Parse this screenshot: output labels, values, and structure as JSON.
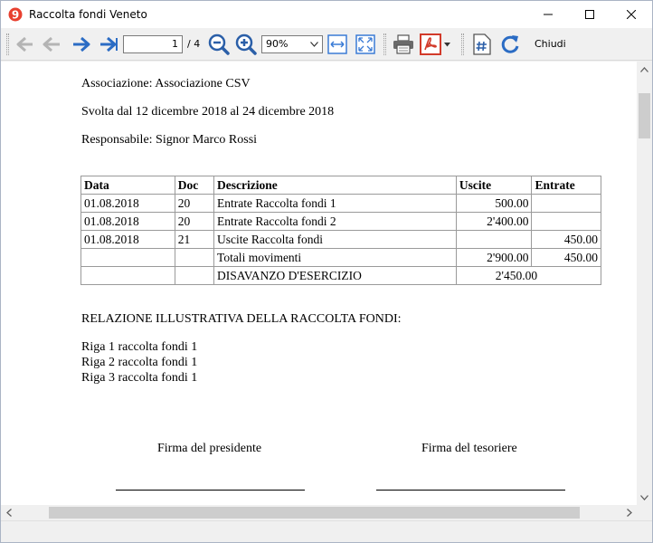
{
  "window": {
    "title": "Raccolta fondi Veneto"
  },
  "toolbar": {
    "page_value": "1",
    "page_total": "/ 4",
    "zoom_value": "90%",
    "close_label": "Chiudi"
  },
  "report": {
    "association": "Associazione: Associazione CSV",
    "period": "Svolta dal 12 dicembre 2018 al 24 dicembre 2018",
    "manager": "Responsabile: Signor Marco Rossi",
    "table": {
      "headers": [
        "Data",
        "Doc",
        "Descrizione",
        "Uscite",
        "Entrate"
      ],
      "rows": [
        {
          "data": "01.08.2018",
          "doc": "20",
          "descrizione": "Entrate Raccolta fondi 1",
          "uscite": "500.00",
          "entrate": ""
        },
        {
          "data": "01.08.2018",
          "doc": "20",
          "descrizione": "Entrate Raccolta fondi 2",
          "uscite": "2'400.00",
          "entrate": ""
        },
        {
          "data": "01.08.2018",
          "doc": "21",
          "descrizione": "Uscite Raccolta fondi",
          "uscite": "",
          "entrate": "450.00"
        }
      ],
      "totals_label": "Totali movimenti",
      "totals_uscite": "2'900.00",
      "totals_entrate": "450.00",
      "deficit_label": "DISAVANZO D'ESERCIZIO",
      "deficit_value": "2'450.00"
    },
    "report_heading": "RELAZIONE ILLUSTRATIVA DELLA RACCOLTA FONDI:",
    "lines": [
      "Riga 1 raccolta fondi 1",
      "Riga 2 raccolta fondi 1",
      "Riga 3 raccolta fondi 1"
    ],
    "signature_president": "Firma del presidente",
    "signature_treasurer": "Firma del tesoriere"
  },
  "icons": {
    "first_page": "arrow-left-end-icon",
    "prev_page": "arrow-left-icon",
    "next_page": "arrow-right-icon",
    "last_page": "arrow-right-end-icon",
    "zoom_out": "zoom-out-icon",
    "zoom_in": "zoom-in-icon",
    "fit_width": "fit-width-icon",
    "fit_page": "fit-page-icon",
    "print": "printer-icon",
    "pdf": "pdf-icon",
    "page_number": "page-number-icon",
    "refresh": "refresh-icon"
  },
  "colors": {
    "accent_blue": "#2b6cc4",
    "pdf_red": "#d23a2a",
    "app_icon_red": "#e8402f"
  }
}
